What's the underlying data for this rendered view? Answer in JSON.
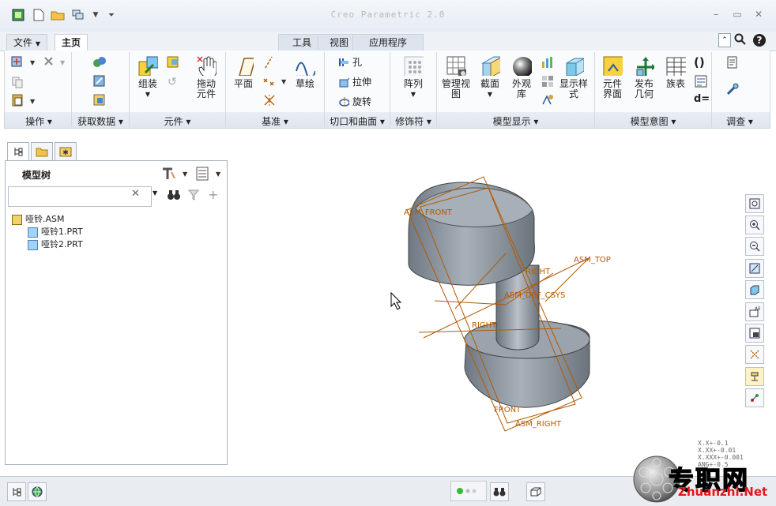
{
  "window": {
    "title": "Creo Parametric 2.0",
    "min": "–",
    "max": "▭",
    "close": "✕"
  },
  "menu": {
    "file": "文件",
    "home": "主页",
    "tabs": [
      "工具",
      "视图",
      "应用程序"
    ]
  },
  "ribbon": {
    "groups": [
      "操作",
      "获取数据",
      "元件",
      "基准",
      "切口和曲面",
      "修饰符",
      "模型显示",
      "模型意图",
      "调查"
    ],
    "buttons": {
      "assemble": "组装",
      "drag": "拖动\n元件",
      "plane": "平面",
      "sketch": "草绘",
      "hole": "孔",
      "extrude": "拉伸",
      "revolve": "旋转",
      "pattern": "阵列",
      "manage_views": "管理视\n图",
      "section": "截面",
      "appearance": "外观\n库",
      "display_style": "显示样\n式",
      "component_interface": "元件\n界面",
      "publish_geometry": "发布\n几何",
      "family_table": "族表",
      "d_equals": "d="
    }
  },
  "left_panel": {
    "title": "模型树",
    "search_placeholder": "",
    "tree": [
      {
        "label": "哑铃.ASM",
        "level": 0
      },
      {
        "label": "哑铃1.PRT",
        "level": 1
      },
      {
        "label": "哑铃2.PRT",
        "level": 1
      }
    ]
  },
  "viewport": {
    "datum_labels": [
      "ASM_FRONT",
      "ASM_TOP",
      "RIGHT",
      "ASM_DEF_CSYS",
      "RIGHT",
      "FRONT",
      "ASM_RIGHT"
    ],
    "tolerance_lines": [
      "X.X+-0.1",
      "X.XX+-0.01",
      "X.XXX+-0.001",
      "ANG+-0.5"
    ]
  },
  "watermark": {
    "cn": "专职网",
    "url": "Zhuanzhi.Net"
  },
  "colors": {
    "datum": "#b35a00",
    "model": "#8f97a1",
    "status_green": "#33bb33"
  }
}
